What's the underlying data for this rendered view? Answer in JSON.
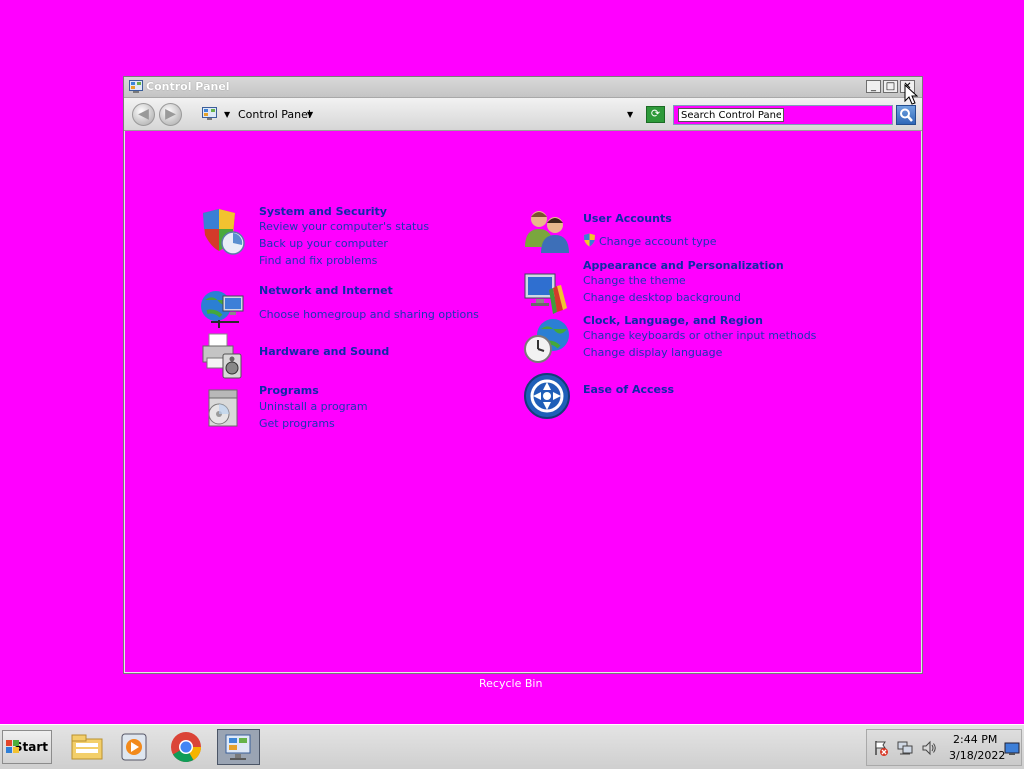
{
  "window": {
    "title": "Control Panel",
    "buttons": {
      "minimize": "_",
      "maximize": "□",
      "close": "✕"
    }
  },
  "toolbar": {
    "breadcrumb": "Control Panel",
    "back_glyph": "◀",
    "forward_glyph": "▶",
    "search_placeholder": "Search Control Panel",
    "search_value": "Search Control Panel"
  },
  "categories": [
    {
      "title": "System and Security",
      "icon": "shield-chart-icon",
      "links": [
        "Review your computer's status",
        "Back up your computer",
        "Find and fix problems"
      ]
    },
    {
      "title": "Network and Internet",
      "icon": "globe-network-icon",
      "links": [
        "Choose homegroup and sharing options"
      ]
    },
    {
      "title": "Hardware and Sound",
      "icon": "printer-speaker-icon",
      "links": []
    },
    {
      "title": "Programs",
      "icon": "programs-box-icon",
      "links": [
        "Uninstall a program",
        "Get programs"
      ]
    },
    {
      "title": "User Accounts",
      "icon": "users-icon",
      "links": [
        "Change account type"
      ]
    },
    {
      "title": "Appearance and Personalization",
      "icon": "monitor-paint-icon",
      "links": [
        "Change the theme",
        "Change desktop background"
      ]
    },
    {
      "title": "Clock, Language, and Region",
      "icon": "clock-globe-icon",
      "links": [
        "Change keyboards or other input methods",
        "Change display language"
      ]
    },
    {
      "title": "Ease of Access",
      "icon": "ease-of-access-icon",
      "links": []
    }
  ],
  "desktop": {
    "recycle_bin_label": "Recycle Bin"
  },
  "taskbar": {
    "start_label": "Start",
    "apps": [
      "file-explorer-icon",
      "media-player-icon",
      "chrome-icon",
      "control-panel-icon"
    ],
    "clock_time": "2:44 PM",
    "clock_date": "3/18/2022"
  },
  "colors": {
    "background": "#ff00ff",
    "link": "#1a35b5",
    "title": "#0f2aa8"
  }
}
